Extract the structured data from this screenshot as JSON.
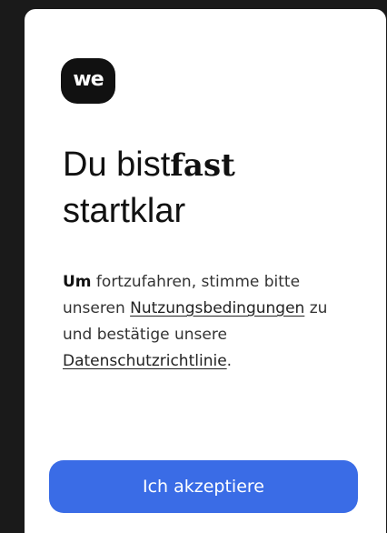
{
  "logo": {
    "text": "we",
    "icon": "we-logo-icon"
  },
  "headline": {
    "part1": "Du bist",
    "part_bold": "fast",
    "part2": "startklar"
  },
  "body": {
    "lead": "Um",
    "text1": " fortzufahren, stimme bitte unseren ",
    "link_terms": "Nutzungsbedingungen",
    "text2": " zu und bestätige unsere ",
    "link_privacy": "Datenschutzrichtlinie",
    "text3": "."
  },
  "cta": {
    "label": "Ich akzeptiere"
  },
  "colors": {
    "accent": "#3a6ce6",
    "card": "#ffffff",
    "background": "#1a1a1a"
  }
}
